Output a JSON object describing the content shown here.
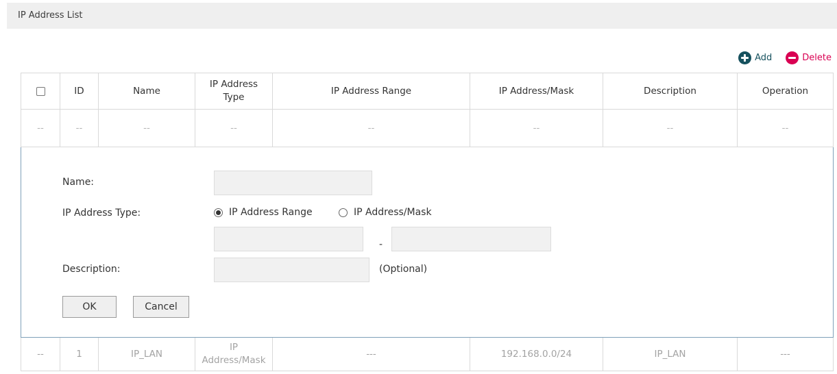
{
  "section": {
    "title": "IP Address List"
  },
  "toolbar": {
    "add_label": "Add",
    "delete_label": "Delete",
    "add_color": "#16515e",
    "delete_color": "#d90052"
  },
  "table": {
    "columns": [
      "ID",
      "Name",
      "IP Address Type",
      "IP Address Range",
      "IP Address/Mask",
      "Description",
      "Operation"
    ],
    "column_type_line1": "IP Address",
    "column_type_line2": "Type",
    "empty_row": [
      "--",
      "--",
      "--",
      "--",
      "--",
      "--",
      "--",
      "--"
    ],
    "rows": [
      {
        "check": "--",
        "id": "1",
        "name": "IP_LAN",
        "type_line1": "IP",
        "type_line2": "Address/Mask",
        "range": "---",
        "mask": "192.168.0.0/24",
        "description": "IP_LAN",
        "operation": "---"
      }
    ]
  },
  "form": {
    "name_label": "Name:",
    "name_value": "",
    "type_label": "IP Address Type:",
    "type_options": [
      "IP Address Range",
      "IP Address/Mask"
    ],
    "type_selected": "IP Address Range",
    "range_start": "",
    "range_separator": "-",
    "range_end": "",
    "description_label": "Description:",
    "description_value": "",
    "description_hint": "(Optional)",
    "ok_label": "OK",
    "cancel_label": "Cancel"
  }
}
